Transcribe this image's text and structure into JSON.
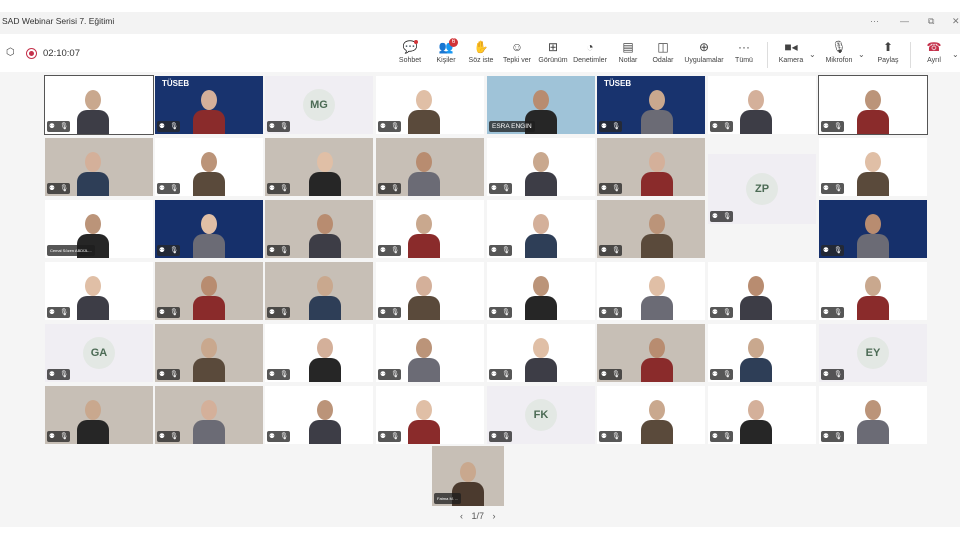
{
  "window": {
    "title": "SAD Webinar Serisi 7. Eğitimi",
    "more": "···",
    "minimize": "—",
    "maximize": "⧉",
    "close": "✕"
  },
  "meeting": {
    "timer": "02:10:07"
  },
  "toolbar": {
    "chat": {
      "label": "Sohbet",
      "icon": "💬"
    },
    "people": {
      "label": "Kişiler",
      "icon": "👥",
      "badge": "6"
    },
    "raise": {
      "label": "Söz iste",
      "icon": "✋"
    },
    "react": {
      "label": "Tepki ver",
      "icon": "☺"
    },
    "view": {
      "label": "Görünüm",
      "icon": "⊞"
    },
    "controls": {
      "label": "Denetimler",
      "icon": "◔"
    },
    "notes": {
      "label": "Notlar",
      "icon": "▤"
    },
    "rooms": {
      "label": "Odalar",
      "icon": "◫"
    },
    "apps": {
      "label": "Uygulamalar",
      "icon": "⊕"
    },
    "more": {
      "label": "Tümü",
      "icon": "···"
    },
    "camera": {
      "label": "Kamera",
      "icon": "■◂"
    },
    "mic": {
      "label": "Mikrofon",
      "icon": "🎙"
    },
    "share": {
      "label": "Paylaş",
      "icon": "⬆"
    },
    "leave": {
      "label": "Ayrıl",
      "icon": "☎"
    },
    "chevron": "⌄"
  },
  "participants": {
    "initials": {
      "mg": "MG",
      "zp": "ZP",
      "ga": "GA",
      "ey": "EY",
      "fk": "FK"
    },
    "named": {
      "esra": "ESRA ENGIN"
    },
    "logo": "TÜSEB",
    "chip_small": "Cemal Sözen ABDÜL...",
    "chip_bottom": "Fatma M. ..."
  },
  "pager": {
    "prev": "‹",
    "label": "1/7",
    "next": "›"
  }
}
